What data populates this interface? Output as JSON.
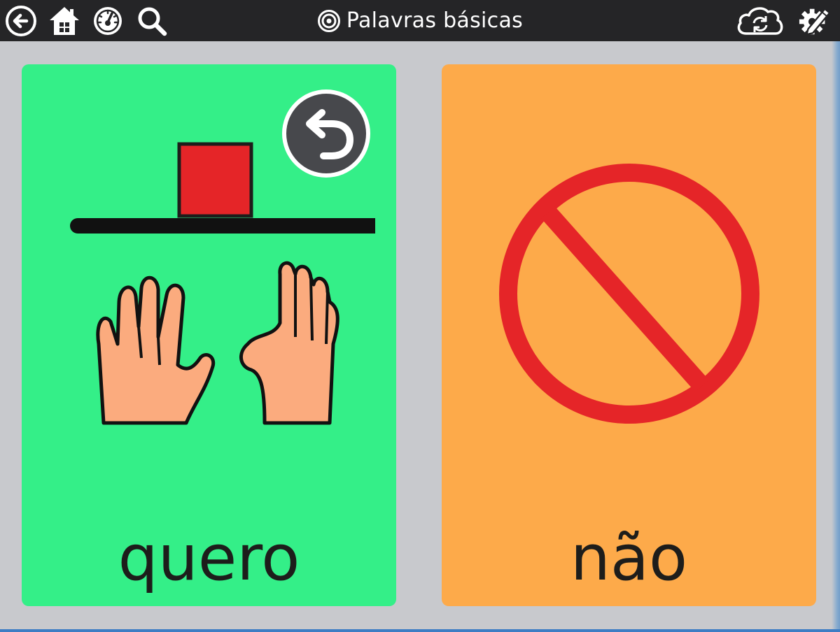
{
  "toolbar": {
    "title": "Palavras básicas",
    "icons": {
      "back": "back-arrow-icon",
      "home": "home-icon",
      "dashboard": "speedometer-icon",
      "search": "search-icon",
      "title": "target-icon",
      "sync": "cloud-sync-icon",
      "edit": "gear-pencil-icon"
    }
  },
  "tiles": [
    {
      "label": "quero",
      "color": "#34ef88",
      "symbol": "want-hands-symbol"
    },
    {
      "label": "não",
      "color": "#fdaa4a",
      "symbol": "prohibited-symbol"
    }
  ],
  "undo": {
    "icon": "undo-icon"
  },
  "colors": {
    "toolbar": "#252527",
    "background": "#c8c9cd",
    "tile_green": "#34ef88",
    "tile_orange": "#fdaa4a",
    "symbol_red": "#e52528"
  }
}
